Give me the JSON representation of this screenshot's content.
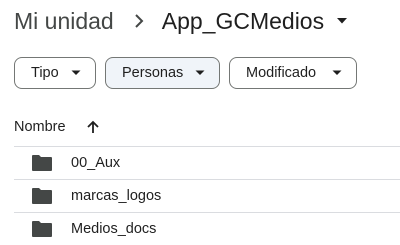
{
  "breadcrumb": {
    "parent": "Mi unidad",
    "current": "App_GCMedios",
    "separator_icon": "chevron-right-icon",
    "caret_icon": "caret-down-icon"
  },
  "filters": [
    {
      "label": "Tipo",
      "selected": false
    },
    {
      "label": "Personas",
      "selected": true
    },
    {
      "label": "Modificado",
      "selected": false
    }
  ],
  "list": {
    "column_header": "Nombre",
    "sort_icon": "arrow-up-icon",
    "items": [
      {
        "name": "00_Aux",
        "icon": "folder-icon"
      },
      {
        "name": "marcas_logos",
        "icon": "folder-icon"
      },
      {
        "name": "Medios_docs",
        "icon": "folder-icon"
      }
    ]
  },
  "colors": {
    "text": "#1f1f1f",
    "muted_text": "#444746",
    "chip_border": "#747775",
    "chip_selected_bg": "#f0f4f9",
    "divider": "#dadce0",
    "folder": "#444746"
  }
}
